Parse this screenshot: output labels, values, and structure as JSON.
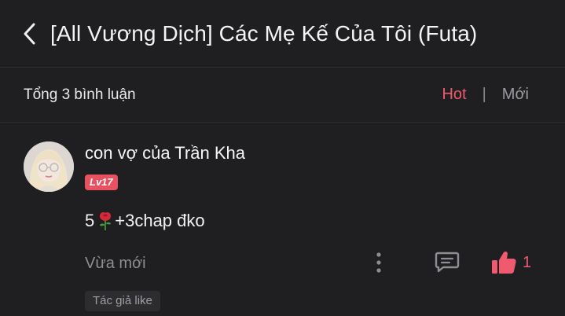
{
  "header": {
    "title": "[All Vương Dịch] Các Mẹ Kế Của Tôi (Futa)"
  },
  "comments_bar": {
    "total_label": "Tổng 3 bình luận",
    "sort_hot": "Hot",
    "sort_separator": "|",
    "sort_new": "Mới"
  },
  "comment": {
    "username": "con vợ của Trần Kha",
    "level": "Lv17",
    "text_before": "5",
    "text_after": "+3chap đko",
    "time": "Vừa mới",
    "like_count": "1",
    "author_badge": "Tác giả like"
  },
  "colors": {
    "background": "#1f1f21",
    "accent": "#ef5a6f",
    "level_badge": "#e8515f",
    "muted": "#8e8e92"
  },
  "icons": [
    "chevron-left-icon",
    "avatar",
    "rose-icon",
    "more-vertical-icon",
    "reply-icon",
    "thumbs-up-icon"
  ]
}
